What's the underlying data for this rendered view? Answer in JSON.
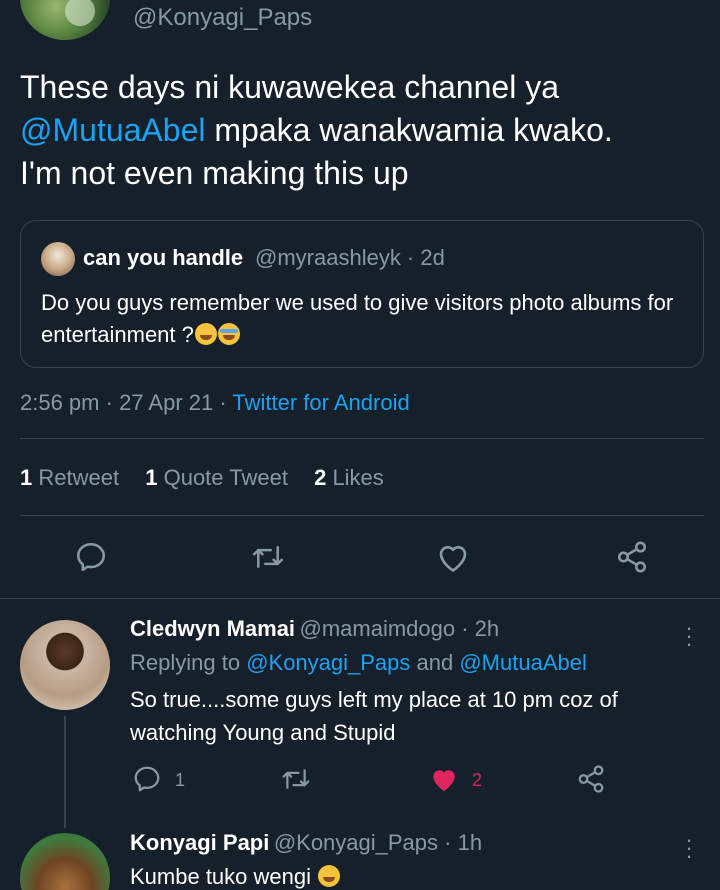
{
  "tweet": {
    "handle": "@Konyagi_Paps",
    "text_1": "These days ni kuwawekea channel ya",
    "mention": "@MutuaAbel",
    "text_2": " mpaka wanakwamia kwako.",
    "text_3": "I'm not even making this up",
    "time": "2:56 pm",
    "date": "27 Apr 21",
    "source": "Twitter for Android",
    "sep": " · "
  },
  "quote": {
    "name": "can you handle",
    "handle": "@myraashleyk · 2d",
    "text": "Do you guys remember we used to give visitors  photo albums for entertainment ?"
  },
  "stats": {
    "retweets_count": "1",
    "retweets_label": "Retweet",
    "quotes_count": "1",
    "quotes_label": "Quote Tweet",
    "likes_count": "2",
    "likes_label": "Likes"
  },
  "replies": [
    {
      "name": "Cledwyn Mamai",
      "handle": "@mamaimdogo · 2h",
      "replying_prefix": "Replying to ",
      "replying_to_1": "@Konyagi_Paps",
      "replying_and": " and ",
      "replying_to_2": "@MutuaAbel",
      "text_1": "So true....some guys left my place at 10 pm coz of",
      "text_2": "watching Young and Stupid",
      "reply_count": "1",
      "like_count": "2"
    },
    {
      "name": "Konyagi Papi",
      "handle": "@Konyagi_Paps · 1h",
      "text_1": "Kumbe tuko wengi"
    }
  ],
  "icons": {
    "reply": "reply-icon",
    "retweet": "retweet-icon",
    "like": "heart-icon",
    "share": "share-icon",
    "more": "more-vertical-icon"
  },
  "colors": {
    "background": "#15202b",
    "accent": "#1da1f2",
    "muted": "#8899a6",
    "like": "#e0245e"
  }
}
